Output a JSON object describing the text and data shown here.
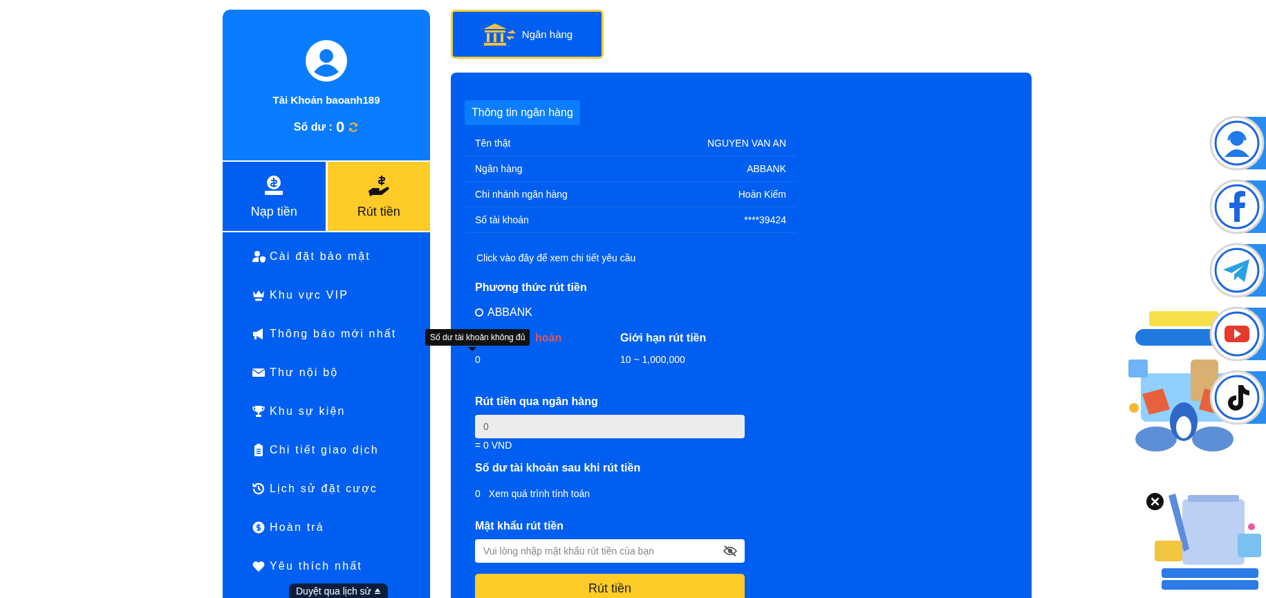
{
  "sidebar": {
    "account_label": "Tài Khoản baoanh189",
    "balance_label": "Số dư :",
    "balance": "0",
    "actions": [
      {
        "label": "Nạp tiền",
        "kind": "deposit",
        "selected": false
      },
      {
        "label": "Rút tiền",
        "kind": "withdraw",
        "selected": true
      }
    ],
    "menu": [
      {
        "label": "Cài đặt bảo mật",
        "kind": "security"
      },
      {
        "label": "Khu vực VIP",
        "kind": "vip"
      },
      {
        "label": "Thông báo mới nhất",
        "kind": "news"
      },
      {
        "label": "Thư nội bộ",
        "kind": "mail"
      },
      {
        "label": "Khu sự kiện",
        "kind": "event"
      },
      {
        "label": "Chi tiết giao dịch",
        "kind": "transactions"
      },
      {
        "label": "Lịch sử đặt cược",
        "kind": "history"
      },
      {
        "label": "Hoàn trả",
        "kind": "rebate"
      },
      {
        "label": "Yêu thích nhất",
        "kind": "favorite"
      }
    ],
    "history_tab": "Duyệt qua lịch sử"
  },
  "tabs": [
    {
      "label": "Ngân hàng",
      "selected": true
    }
  ],
  "bank_info": {
    "title": "Thông tin ngân hàng",
    "rows": [
      {
        "label": "Tên thật",
        "value": "NGUYEN VAN AN"
      },
      {
        "label": "Ngân hàng",
        "value": "ABBANK"
      },
      {
        "label": "Chi nhánh ngân hàng",
        "value": "Hoàn Kiếm"
      },
      {
        "label": "Số tài khoản",
        "value": "****39424"
      }
    ]
  },
  "details_link": "Click vào đây để xem chi tiết yêu cầu",
  "method": {
    "heading": "Phương thức rút tiền",
    "options": [
      {
        "label": "ABBANK",
        "selected": false
      }
    ]
  },
  "balance": {
    "label": "hoản",
    "value": "0",
    "tooltip": "Số dư tài khoản không đủ"
  },
  "limit": {
    "label": "Giới hạn rút tiền",
    "value": "10 ~ 1,000,000"
  },
  "amount": {
    "heading": "Rút tiền qua ngân hàng",
    "value": "0",
    "disabled": true,
    "converted": "= 0 VND"
  },
  "after": {
    "heading": "Số dư tài khoản sau khi rút tiền",
    "value": "0",
    "link": "Xem quá trình tính toán"
  },
  "password": {
    "heading": "Mật khẩu rút tiền",
    "placeholder": "Vui lòng nhập mật khẩu rút tiền của bạn",
    "visible": false
  },
  "submit": "Rút tiền",
  "floating": [
    {
      "kind": "support"
    },
    {
      "kind": "facebook"
    },
    {
      "kind": "telegram"
    },
    {
      "kind": "youtube"
    },
    {
      "kind": "tiktok"
    }
  ]
}
